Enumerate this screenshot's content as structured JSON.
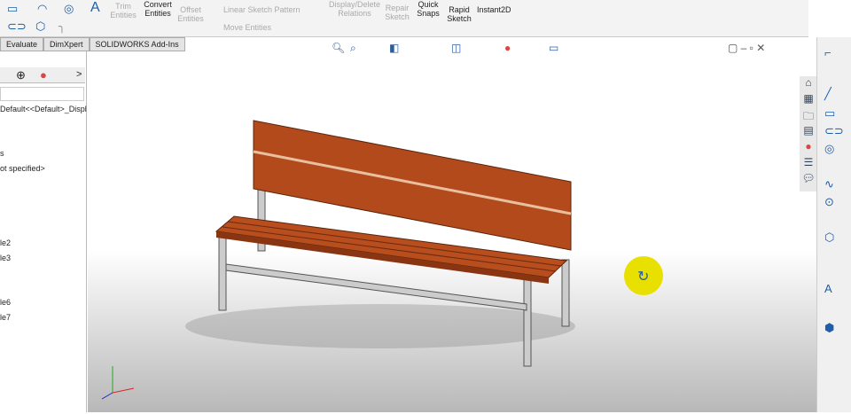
{
  "ribbon": {
    "trim": "Trim Entities",
    "convert": "Convert Entities",
    "offset": "Offset Entities",
    "linear_pattern": "Linear Sketch Pattern",
    "move": "Move Entities",
    "display_relations": "Display/Delete Relations",
    "repair": "Repair Sketch",
    "quick_snaps": "Quick Snaps",
    "rapid_sketch": "Rapid Sketch",
    "instant2d": "Instant2D"
  },
  "tabs": [
    "Evaluate",
    "DimXpert",
    "SOLIDWORKS Add-Ins"
  ],
  "tree": {
    "config": "Default<<Default>_Displ",
    "r1": "s",
    "r2": "ot specified>",
    "r3": "le2",
    "r4": "le3",
    "r5": "le6",
    "r6": "le7",
    "chevron": ">"
  },
  "accent": "#1f5fa8"
}
